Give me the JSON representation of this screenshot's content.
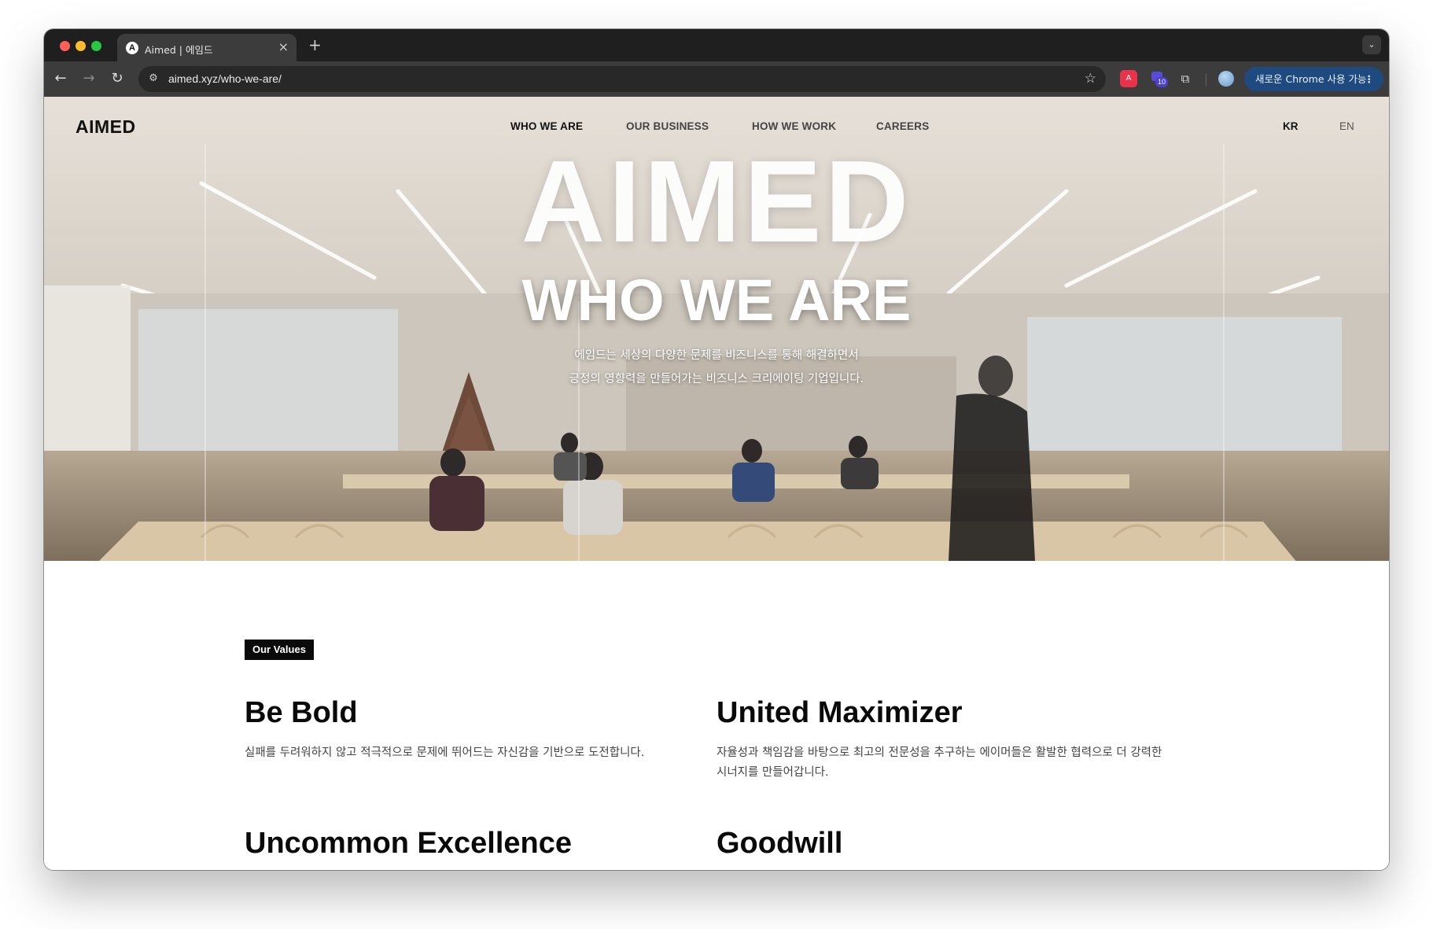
{
  "browser": {
    "tab": {
      "favicon": "A",
      "title": "Aimed | 에임드"
    },
    "new_tab_label": "+",
    "url": "aimed.xyz/who-we-are/",
    "extension_badge_count": "10",
    "update_button_label": "새로운 Chrome 사용 가능",
    "icons": {
      "back": "arrow-left-icon",
      "forward": "arrow-right-icon",
      "reload": "reload-icon",
      "site_info": "tune-icon",
      "bookmark": "star-icon",
      "extensions": "puzzle-icon",
      "menu": "kebab-menu-icon"
    }
  },
  "site": {
    "logo": "AIMED",
    "nav": [
      {
        "label": "WHO WE ARE",
        "active": true
      },
      {
        "label": "OUR BUSINESS",
        "active": false
      },
      {
        "label": "HOW WE WORK",
        "active": false
      },
      {
        "label": "CAREERS",
        "active": false
      }
    ],
    "languages": [
      "KR",
      "EN"
    ]
  },
  "hero": {
    "logo_text": "AIMED",
    "title": "WHO WE ARE",
    "subtitle_line1": "에임드는 세상의 다양한 문제를 비즈니스를 통해 해결하면서",
    "subtitle_line2": "긍정의 영향력을 만들어가는 비즈니스 크리에이팅 기업입니다."
  },
  "values": {
    "badge": "Our Values",
    "items": [
      {
        "title": "Be Bold",
        "description": "실패를 두려워하지 않고 적극적으로 문제에 뛰어드는 자신감을 기반으로 도전합니다."
      },
      {
        "title": "United Maximizer",
        "description_line1": "자율성과 책임감을 바탕으로 최고의 전문성을 추구하는 에이머들은 활발한 협력으로 더 강력한",
        "description_line2": "시너지를 만들어갑니다."
      },
      {
        "title": "Uncommon Excellence"
      },
      {
        "title": "Goodwill"
      }
    ]
  },
  "colors": {
    "tabstrip": "#1f1f1f",
    "toolbar": "#3c3c3c",
    "update_pill": "#1e4a80",
    "badge": "#0a0a0a"
  }
}
